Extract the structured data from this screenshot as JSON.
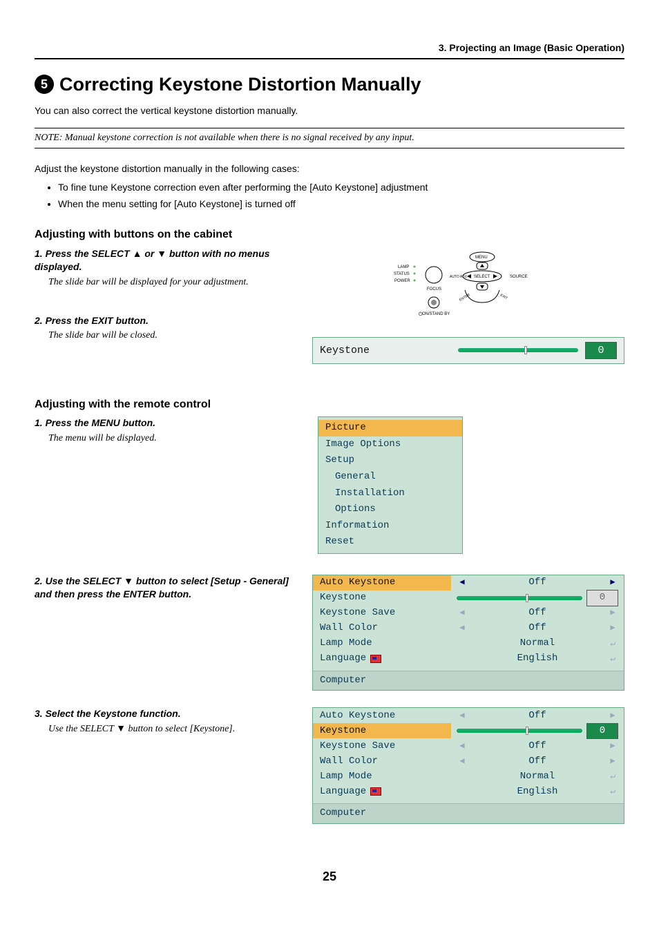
{
  "header": "3. Projecting an Image (Basic Operation)",
  "section_number": "5",
  "section_title": "Correcting Keystone Distortion Manually",
  "intro": "You can also correct the vertical keystone distortion manually.",
  "note": "NOTE: Manual keystone correction is not available when there is no signal received by any input.",
  "adjust_intro": "Adjust the keystone distortion manually in the following cases:",
  "bullets": [
    "To fine tune Keystone correction even after performing the [Auto Keystone] adjustment",
    "When the menu setting for [Auto Keystone] is turned off"
  ],
  "sub1": "Adjusting with buttons on the cabinet",
  "step1_title": "1.  Press the SELECT ▲ or ▼ button with no menus displayed.",
  "step1_desc": "The slide bar will be displayed for your adjustment.",
  "step2_title": "2.  Press the EXIT button.",
  "step2_desc": "The slide bar will be closed.",
  "diagram": {
    "labels": {
      "lamp": "LAMP",
      "status": "STATUS",
      "power": "POWER",
      "menu": "MENU",
      "auto_adj": "AUTO ADJ.",
      "select": "SELECT",
      "source": "SOURCE",
      "focus": "FOCUS",
      "enter": "ENTER",
      "exit": "EXIT",
      "standby": "ON/STAND BY"
    }
  },
  "keystone_bar": {
    "label": "Keystone",
    "value": "0",
    "pos": 55
  },
  "sub2": "Adjusting with the remote control",
  "r_step1_title": "1.  Press the MENU button.",
  "r_step1_desc": "The menu will be displayed.",
  "menu1": {
    "items": [
      "Picture",
      "Image Options",
      "Setup",
      "General",
      "Installation",
      "Options",
      "Information",
      "Reset"
    ],
    "highlighted": 0,
    "indent_start": 3,
    "indent_end": 5
  },
  "r_step2_title": "2.  Use the SELECT ▼ button to select [Setup - General] and then press the ENTER button.",
  "table1": {
    "highlight": 0,
    "rows": [
      {
        "label": "Auto Keystone",
        "mode": "arrows_lit",
        "value": "Off"
      },
      {
        "label": "Keystone",
        "mode": "slider",
        "value": "0",
        "active": false,
        "pos": 55
      },
      {
        "label": "Keystone Save",
        "mode": "arrows_dim",
        "value": "Off"
      },
      {
        "label": "Wall Color",
        "mode": "arrows_dim",
        "value": "Off"
      },
      {
        "label": "Lamp Mode",
        "mode": "enter",
        "value": "Normal"
      },
      {
        "label": "Language",
        "mode": "enter",
        "value": "English",
        "icon": true
      }
    ],
    "footer": "Computer"
  },
  "r_step3_title": "3.  Select the Keystone function.",
  "r_step3_desc": "Use the SELECT ▼ button to select [Keystone].",
  "table2": {
    "highlight": 1,
    "rows": [
      {
        "label": "Auto Keystone",
        "mode": "arrows_dim",
        "value": "Off"
      },
      {
        "label": "Keystone",
        "mode": "slider",
        "value": "0",
        "active": true,
        "pos": 55
      },
      {
        "label": "Keystone Save",
        "mode": "arrows_dim",
        "value": "Off"
      },
      {
        "label": "Wall Color",
        "mode": "arrows_dim",
        "value": "Off"
      },
      {
        "label": "Lamp Mode",
        "mode": "enter",
        "value": "Normal"
      },
      {
        "label": "Language",
        "mode": "enter",
        "value": "English",
        "icon": true
      }
    ],
    "footer": "Computer"
  },
  "page_num": "25"
}
